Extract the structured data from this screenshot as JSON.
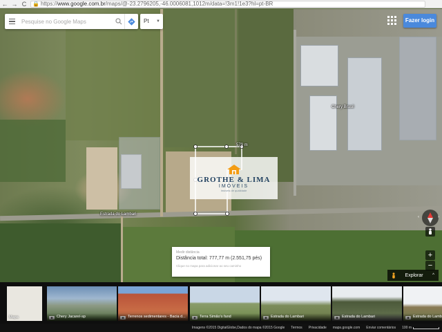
{
  "browser": {
    "back_glyph": "←",
    "forward_glyph": "→",
    "reload_glyph": "C",
    "url_scheme": "https://",
    "url_host": "www.google.com.br",
    "url_path": "/maps/@-23.2796205,-46.0006081,1012m/data=!3m1!1e3?hl=pt-BR"
  },
  "search": {
    "placeholder": "Pesquise no Google Maps"
  },
  "language": {
    "selected": "Pt"
  },
  "header": {
    "login_label": "Fazer login"
  },
  "map_labels": {
    "chery_brasil": "Chery Brasil",
    "street": "Estrada do Lambari",
    "ruler_label": "579 m"
  },
  "watermark": {
    "name": "GROTHE & LIMA",
    "sub": "IMÓVEIS",
    "tag": "Imóveis de qualidade"
  },
  "measure": {
    "title": "Medir distância",
    "distance": "Distância total: 777,77 m (2.551,75 pés)",
    "hint": "Clique no mapa para adicionar ao seu caminho"
  },
  "controls": {
    "zoom_in": "+",
    "zoom_out": "−",
    "compass_left": "‹",
    "compass_right": "›",
    "explore_label": "Explorar",
    "explore_chevron": "^"
  },
  "photos": [
    {
      "caption": "Mapa",
      "kind": "map"
    },
    {
      "caption": "Chery Jacareí-sp",
      "kind": "photo"
    },
    {
      "caption": "Terrenos sedimentares - Bacia d...",
      "kind": "photo"
    },
    {
      "caption": "Terra Simão's fand",
      "kind": "photo"
    },
    {
      "caption": "Estrada do Lambari",
      "kind": "photo"
    },
    {
      "caption": "Estrada do Lambari",
      "kind": "photo"
    },
    {
      "caption": "Estrada do Lambari",
      "kind": "photo"
    }
  ],
  "footer": {
    "imagery": "Imagens ©2015 DigitalGlobe,Dados do mapa ©2015 Google",
    "terms": "Termos",
    "privacy": "Privacidade",
    "domain": "maps.google.com",
    "feedback": "Enviar comentários",
    "scale": "100 m"
  },
  "colors": {
    "login_blue": "#4a89dc",
    "measure_line": "#ffffff",
    "watermark_navy": "#1f3f5f",
    "watermark_orange": "#f39c12"
  }
}
